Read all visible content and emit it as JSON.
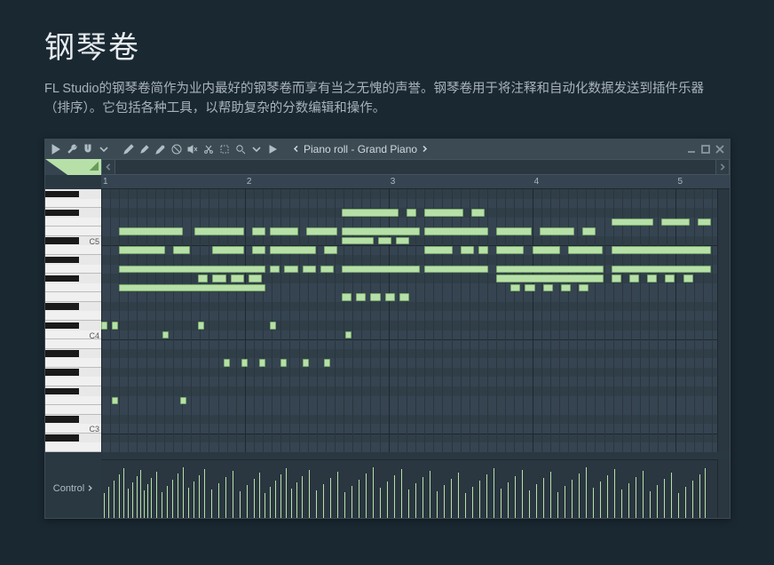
{
  "page": {
    "heading": "钢琴卷",
    "description": "FL Studio的钢琴卷简作为业内最好的钢琴卷而享有当之无愧的声誉。钢琴卷用于将注释和自动化数据发送到插件乐器（排序）。它包括各种工具，以帮助复杂的分数编辑和操作。"
  },
  "window": {
    "title": "Piano roll - Grand Piano"
  },
  "ruler": {
    "bars": [
      "1",
      "2",
      "3",
      "4",
      "5"
    ]
  },
  "piano": {
    "labels": [
      "C5",
      "C4",
      "C3"
    ]
  },
  "control": {
    "label": "Control"
  },
  "colors": {
    "note": "#b6e0a8",
    "bg": "#354450"
  },
  "notes": [
    {
      "x": 0.5,
      "w": 1.8,
      "row": 4
    },
    {
      "x": 2.6,
      "w": 1.4,
      "row": 4
    },
    {
      "x": 4.2,
      "w": 0.4,
      "row": 4
    },
    {
      "x": 0.5,
      "w": 1.3,
      "row": 6
    },
    {
      "x": 2.0,
      "w": 0.5,
      "row": 6
    },
    {
      "x": 3.1,
      "w": 0.9,
      "row": 6
    },
    {
      "x": 4.2,
      "w": 0.4,
      "row": 6
    },
    {
      "x": 0.5,
      "w": 4.1,
      "row": 8
    },
    {
      "x": 2.7,
      "w": 0.3,
      "row": 9
    },
    {
      "x": 3.1,
      "w": 0.4,
      "row": 9
    },
    {
      "x": 3.6,
      "w": 0.4,
      "row": 9
    },
    {
      "x": 4.1,
      "w": 0.4,
      "row": 9
    },
    {
      "x": 0.5,
      "w": 4.1,
      "row": 10
    },
    {
      "x": 4.7,
      "w": 1.3,
      "row": 6
    },
    {
      "x": 6.2,
      "w": 0.4,
      "row": 6
    },
    {
      "x": 4.7,
      "w": 0.8,
      "row": 4
    },
    {
      "x": 5.7,
      "w": 0.9,
      "row": 4
    },
    {
      "x": 4.7,
      "w": 0.3,
      "row": 8
    },
    {
      "x": 5.1,
      "w": 0.4,
      "row": 8
    },
    {
      "x": 5.6,
      "w": 0.4,
      "row": 8
    },
    {
      "x": 6.1,
      "w": 0.4,
      "row": 8
    },
    {
      "x": 6.7,
      "w": 1.6,
      "row": 2
    },
    {
      "x": 8.5,
      "w": 0.3,
      "row": 2
    },
    {
      "x": 6.7,
      "w": 2.2,
      "row": 4
    },
    {
      "x": 6.7,
      "w": 0.9,
      "row": 5
    },
    {
      "x": 7.7,
      "w": 0.4,
      "row": 5
    },
    {
      "x": 8.2,
      "w": 0.4,
      "row": 5
    },
    {
      "x": 6.7,
      "w": 2.2,
      "row": 8
    },
    {
      "x": 6.7,
      "w": 0.3,
      "row": 11
    },
    {
      "x": 7.1,
      "w": 0.3,
      "row": 11
    },
    {
      "x": 7.5,
      "w": 0.3,
      "row": 11
    },
    {
      "x": 7.9,
      "w": 0.3,
      "row": 11
    },
    {
      "x": 8.3,
      "w": 0.3,
      "row": 11
    },
    {
      "x": 9.0,
      "w": 1.1,
      "row": 2
    },
    {
      "x": 10.3,
      "w": 0.4,
      "row": 2
    },
    {
      "x": 9.0,
      "w": 1.8,
      "row": 4
    },
    {
      "x": 9.0,
      "w": 0.8,
      "row": 6
    },
    {
      "x": 10.0,
      "w": 0.4,
      "row": 6
    },
    {
      "x": 10.5,
      "w": 0.3,
      "row": 6
    },
    {
      "x": 9.0,
      "w": 1.8,
      "row": 8
    },
    {
      "x": 11.0,
      "w": 1.0,
      "row": 4
    },
    {
      "x": 12.2,
      "w": 1.0,
      "row": 4
    },
    {
      "x": 13.4,
      "w": 0.4,
      "row": 4
    },
    {
      "x": 11.0,
      "w": 0.8,
      "row": 6
    },
    {
      "x": 12.0,
      "w": 0.8,
      "row": 6
    },
    {
      "x": 13.0,
      "w": 1.0,
      "row": 6
    },
    {
      "x": 11.0,
      "w": 3.0,
      "row": 8
    },
    {
      "x": 11.0,
      "w": 3.0,
      "row": 9
    },
    {
      "x": 11.4,
      "w": 0.3,
      "row": 10
    },
    {
      "x": 11.8,
      "w": 0.3,
      "row": 10
    },
    {
      "x": 12.3,
      "w": 0.3,
      "row": 10
    },
    {
      "x": 12.8,
      "w": 0.3,
      "row": 10
    },
    {
      "x": 13.3,
      "w": 0.3,
      "row": 10
    },
    {
      "x": 14.2,
      "w": 1.2,
      "row": 3
    },
    {
      "x": 15.6,
      "w": 0.8,
      "row": 3
    },
    {
      "x": 16.6,
      "w": 0.4,
      "row": 3
    },
    {
      "x": 14.2,
      "w": 2.8,
      "row": 6
    },
    {
      "x": 14.2,
      "w": 2.8,
      "row": 8
    },
    {
      "x": 14.2,
      "w": 0.3,
      "row": 9
    },
    {
      "x": 14.7,
      "w": 0.3,
      "row": 9
    },
    {
      "x": 15.2,
      "w": 0.3,
      "row": 9
    },
    {
      "x": 15.7,
      "w": 0.3,
      "row": 9
    },
    {
      "x": 16.2,
      "w": 0.3,
      "row": 9
    },
    {
      "x": 17.2,
      "w": 2.0,
      "row": 6
    },
    {
      "x": 17.2,
      "w": 2.0,
      "row": 8
    },
    {
      "x": 17.2,
      "w": 0.8,
      "row": 4
    },
    {
      "x": 18.2,
      "w": 0.8,
      "row": 4
    },
    {
      "x": 0.0,
      "w": 0.2,
      "row": 14
    },
    {
      "x": 0.3,
      "w": 0.2,
      "row": 14
    },
    {
      "x": 2.7,
      "w": 0.2,
      "row": 14
    },
    {
      "x": 4.7,
      "w": 0.2,
      "row": 14
    },
    {
      "x": 1.7,
      "w": 0.2,
      "row": 15
    },
    {
      "x": 6.8,
      "w": 0.2,
      "row": 15
    },
    {
      "x": 3.4,
      "w": 0.2,
      "row": 18
    },
    {
      "x": 3.9,
      "w": 0.2,
      "row": 18
    },
    {
      "x": 4.4,
      "w": 0.2,
      "row": 18
    },
    {
      "x": 5.0,
      "w": 0.2,
      "row": 18
    },
    {
      "x": 5.6,
      "w": 0.2,
      "row": 18
    },
    {
      "x": 6.2,
      "w": 0.2,
      "row": 18
    },
    {
      "x": 0.3,
      "w": 0.2,
      "row": 22
    },
    {
      "x": 2.2,
      "w": 0.2,
      "row": 22
    }
  ],
  "velocity_bars": [
    3,
    8,
    14,
    20,
    25,
    30,
    35,
    40,
    44,
    48,
    52,
    56,
    62,
    68,
    74,
    80,
    86,
    92,
    98,
    104,
    110,
    116,
    124,
    132,
    140,
    148,
    156,
    164,
    172,
    178,
    184,
    190,
    196,
    202,
    208,
    214,
    220,
    226,
    234,
    242,
    250,
    258,
    266,
    274,
    282,
    290,
    298,
    306,
    314,
    322,
    330,
    338,
    346,
    354,
    362,
    370,
    378,
    386,
    394,
    402,
    410,
    418,
    426,
    434,
    442,
    450,
    458,
    466,
    474,
    482,
    490,
    498,
    506,
    514,
    522,
    530,
    538,
    546,
    554,
    562,
    570,
    578,
    586,
    594,
    602,
    610,
    618,
    626,
    634,
    642,
    650,
    658,
    666,
    674,
    680
  ]
}
